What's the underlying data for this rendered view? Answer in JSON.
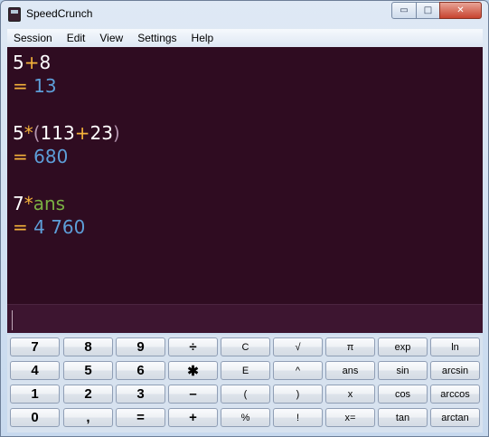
{
  "window": {
    "title": "SpeedCrunch",
    "controls": {
      "minimize": "▭",
      "maximize": "□",
      "close": "✕"
    }
  },
  "menu": [
    "Session",
    "Edit",
    "View",
    "Settings",
    "Help"
  ],
  "history": [
    {
      "expression": [
        {
          "t": "num",
          "v": "5"
        },
        {
          "t": "op",
          "v": "+"
        },
        {
          "t": "num",
          "v": "8"
        }
      ],
      "result": "13"
    },
    {
      "expression": [
        {
          "t": "num",
          "v": "5"
        },
        {
          "t": "op",
          "v": "*"
        },
        {
          "t": "paren",
          "v": "("
        },
        {
          "t": "num",
          "v": "113"
        },
        {
          "t": "op",
          "v": "+"
        },
        {
          "t": "num",
          "v": "23"
        },
        {
          "t": "paren",
          "v": ")"
        }
      ],
      "result": "680"
    },
    {
      "expression": [
        {
          "t": "num",
          "v": "7"
        },
        {
          "t": "op",
          "v": "*"
        },
        {
          "t": "var",
          "v": "ans"
        }
      ],
      "result": "4 760"
    }
  ],
  "result_prefix": "=",
  "editor": {
    "value": ""
  },
  "keypad": [
    [
      "7",
      "8",
      "9",
      "÷",
      "C",
      "√",
      "π",
      "exp",
      "ln"
    ],
    [
      "4",
      "5",
      "6",
      "✱",
      "E",
      "^",
      "ans",
      "sin",
      "arcsin"
    ],
    [
      "1",
      "2",
      "3",
      "–",
      "(",
      ")",
      "x",
      "cos",
      "arccos"
    ],
    [
      "0",
      ",",
      "=",
      "+",
      "%",
      "!",
      "x=",
      "tan",
      "arctan"
    ]
  ],
  "colors": {
    "display_bg": "#2f0c21",
    "number": "#ffffff",
    "operator": "#f4b23a",
    "paren": "#b394ae",
    "variable": "#7ab043",
    "result": "#5d9ed8"
  }
}
